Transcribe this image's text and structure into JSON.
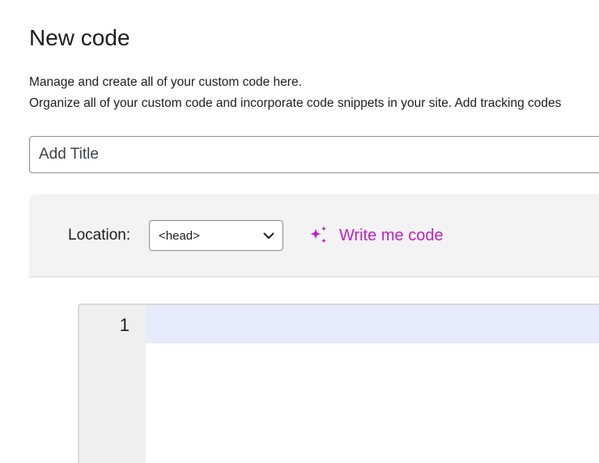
{
  "page": {
    "title": "New code",
    "description_line1": "Manage and create all of your custom code here.",
    "description_line2": "Organize all of your custom code and incorporate code snippets in your site. Add tracking codes"
  },
  "title_field": {
    "placeholder": "Add Title",
    "value": ""
  },
  "location": {
    "label": "Location:",
    "selected": "<head>"
  },
  "ai": {
    "label": "Write me code",
    "icon": "sparkle-icon",
    "color": "#c11fc8"
  },
  "editor": {
    "line_numbers": [
      "1"
    ],
    "active_line_color": "#e6ebfb"
  }
}
